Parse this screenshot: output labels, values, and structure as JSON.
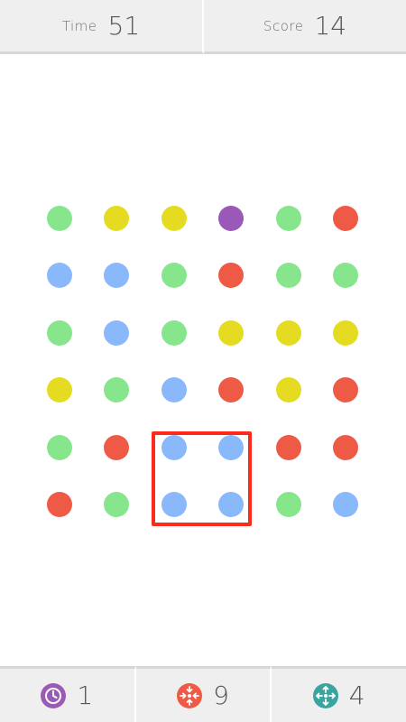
{
  "header": {
    "time_label": "Time",
    "time_value": "51",
    "score_label": "Score",
    "score_value": "14"
  },
  "colors": {
    "green": "#87e68c",
    "yellow": "#e5dc21",
    "purple": "#9a59b8",
    "red": "#ee5a45",
    "blue": "#8ab9fb",
    "selection": "#ff2a1a",
    "timestop_icon": "#9b5bb5",
    "shrinker_icon": "#ee5a45",
    "expander_icon": "#3aa5a0"
  },
  "board": {
    "rows": 6,
    "cols": 6,
    "grid": [
      [
        "green",
        "yellow",
        "yellow",
        "purple",
        "green",
        "red"
      ],
      [
        "blue",
        "blue",
        "green",
        "red",
        "green",
        "green"
      ],
      [
        "green",
        "blue",
        "green",
        "yellow",
        "yellow",
        "yellow"
      ],
      [
        "yellow",
        "green",
        "blue",
        "red",
        "yellow",
        "red"
      ],
      [
        "green",
        "red",
        "blue",
        "blue",
        "red",
        "red"
      ],
      [
        "red",
        "green",
        "blue",
        "blue",
        "green",
        "blue"
      ]
    ],
    "selected_square": {
      "row_start": 4,
      "col_start": 2,
      "row_end": 5,
      "col_end": 3
    }
  },
  "footer": {
    "powerups": [
      {
        "name": "timestop",
        "icon": "clock-icon",
        "count": "1"
      },
      {
        "name": "shrinker",
        "icon": "shrinker-icon",
        "count": "9"
      },
      {
        "name": "expander",
        "icon": "expander-icon",
        "count": "4"
      }
    ]
  }
}
